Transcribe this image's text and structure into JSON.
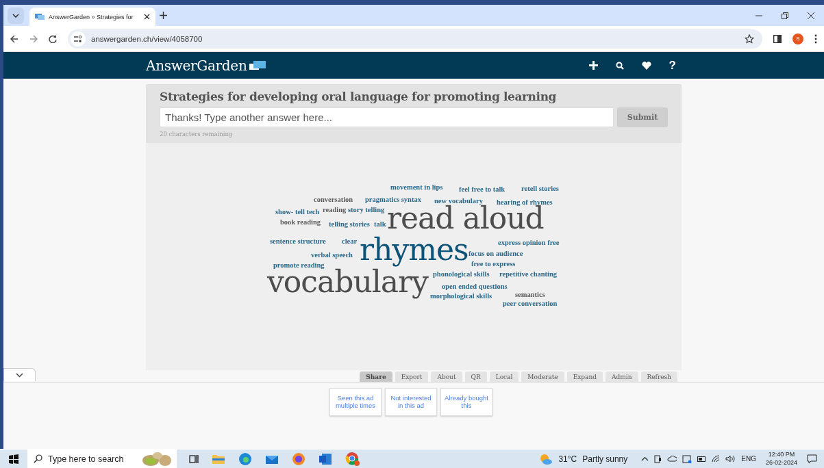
{
  "browser": {
    "tab_title": "AnswerGarden » Strategies for",
    "url": "answergarden.ch/view/4058700",
    "profile_initial": "S"
  },
  "site": {
    "logo": "AnswerGarden",
    "help": "?"
  },
  "question": {
    "title": "Strategies for developing oral language for promoting learning",
    "placeholder": "Thanks! Type another answer here...",
    "submit": "Submit",
    "remaining": "20 characters remaining"
  },
  "cloud": {
    "words": [
      {
        "text": "movement in lips",
        "kind": "small",
        "color": "#2a6889"
      },
      {
        "text": "feel free to talk",
        "kind": "small",
        "color": "#2a6889"
      },
      {
        "text": "retell stories",
        "kind": "small",
        "color": "#2a6889"
      },
      {
        "text": "conversation",
        "kind": "small",
        "color": "#5a5a5a"
      },
      {
        "text": "pragmatics syntax",
        "kind": "small",
        "color": "#2a6889"
      },
      {
        "text": "new vocabulary",
        "kind": "small",
        "color": "#2a6889"
      },
      {
        "text": "hearing of rhymes",
        "kind": "small",
        "color": "#2a6889"
      },
      {
        "text": "show- tell tech",
        "kind": "small",
        "color": "#2a6889"
      },
      {
        "text": "reading",
        "kind": "small",
        "color": "#5a5a5a"
      },
      {
        "text": "story telling",
        "kind": "small",
        "color": "#2a6889"
      },
      {
        "text": "book reading",
        "kind": "small",
        "color": "#5a5a5a"
      },
      {
        "text": "telling stories",
        "kind": "small",
        "color": "#2a6889"
      },
      {
        "text": "talk",
        "kind": "small",
        "color": "#2a6889"
      },
      {
        "text": "read aloud",
        "kind": "large",
        "color": "#4d4d4d"
      },
      {
        "text": "sentence structure",
        "kind": "small",
        "color": "#2a6889"
      },
      {
        "text": "clear",
        "kind": "small",
        "color": "#2a6889"
      },
      {
        "text": "express opinion free",
        "kind": "small",
        "color": "#2a6889"
      },
      {
        "text": "verbal speech",
        "kind": "small",
        "color": "#2a6889"
      },
      {
        "text": "rhymes",
        "kind": "large",
        "color": "#0b5378"
      },
      {
        "text": "focus on audience",
        "kind": "small",
        "color": "#2a6889"
      },
      {
        "text": "promote reading",
        "kind": "small",
        "color": "#2a6889"
      },
      {
        "text": "free to express",
        "kind": "small",
        "color": "#2a6889"
      },
      {
        "text": "vocabulary",
        "kind": "large",
        "color": "#4d4d4d"
      },
      {
        "text": "phonological skills",
        "kind": "small",
        "color": "#2a6889"
      },
      {
        "text": "repetitive chanting",
        "kind": "small",
        "color": "#2a6889"
      },
      {
        "text": "open ended questions",
        "kind": "small",
        "color": "#2a6889"
      },
      {
        "text": "morphological skills",
        "kind": "small",
        "color": "#2a6889"
      },
      {
        "text": "semantics",
        "kind": "small",
        "color": "#5a5a5a"
      },
      {
        "text": "peer conversation",
        "kind": "small",
        "color": "#2a6889"
      }
    ]
  },
  "tabs": [
    {
      "label": "Share",
      "selected": true
    },
    {
      "label": "Export",
      "selected": false
    },
    {
      "label": "About",
      "selected": false
    },
    {
      "label": "QR",
      "selected": false
    },
    {
      "label": "Local",
      "selected": false
    },
    {
      "label": "Moderate",
      "selected": false
    },
    {
      "label": "Expand",
      "selected": false
    },
    {
      "label": "Admin",
      "selected": false
    },
    {
      "label": "Refresh",
      "selected": false
    }
  ],
  "ad_feedback": [
    "Seen this ad multiple times",
    "Not interested in this ad",
    "Already bought this"
  ],
  "taskbar": {
    "search_placeholder": "Type here to search",
    "temperature": "31°C",
    "weather": "Partly sunny",
    "language": "ENG",
    "time": "12:40 PM",
    "date": "26-02-2024"
  }
}
